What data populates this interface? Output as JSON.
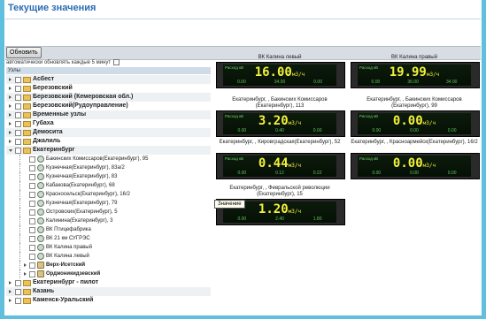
{
  "page": {
    "title": "Текущие значения"
  },
  "toolbar": {
    "refresh_label": "Обновить",
    "auto_refresh_label": "автоматически обновлять каждые 5 минут"
  },
  "tree": {
    "header": "Узлы",
    "nodes": [
      {
        "label": "Асбест",
        "kind": "top",
        "expanded": false
      },
      {
        "label": "Березовский",
        "kind": "top",
        "expanded": false
      },
      {
        "label": "Березовский (Кемеровская обл.)",
        "kind": "top",
        "expanded": false
      },
      {
        "label": "Березовский(Рудоуправление)",
        "kind": "top",
        "expanded": false
      },
      {
        "label": "Временные узлы",
        "kind": "top",
        "expanded": false
      },
      {
        "label": "Губаха",
        "kind": "top",
        "expanded": false
      },
      {
        "label": "Демосита",
        "kind": "top",
        "expanded": false
      },
      {
        "label": "Джалиль",
        "kind": "top",
        "expanded": false
      },
      {
        "label": "Екатеринбург",
        "kind": "top",
        "expanded": true
      },
      {
        "label": "Бакинских Комиссаров(Екатеринбург), 95",
        "kind": "child"
      },
      {
        "label": "Кузнечная(Екатеринбург), 83а/2",
        "kind": "child"
      },
      {
        "label": "Кузнечная(Екатеринбург), 83",
        "kind": "child"
      },
      {
        "label": "Кабакова(Екатеринбург), 68",
        "kind": "child"
      },
      {
        "label": "Красносельск(Екатеринбург), 16/2",
        "kind": "child"
      },
      {
        "label": "Кузнечная(Екатеринбург), 79",
        "kind": "child"
      },
      {
        "label": "Островских(Екатеринбург), 5",
        "kind": "child"
      },
      {
        "label": "Калинина(Екатеринбург), 3",
        "kind": "child"
      },
      {
        "label": "ВК Птицефабрика",
        "kind": "child"
      },
      {
        "label": "ВК 21 км СУГРЭС",
        "kind": "child"
      },
      {
        "label": "ВК Калина правый",
        "kind": "child"
      },
      {
        "label": "ВК Калина левый",
        "kind": "child"
      },
      {
        "label": "Верх-Исетский",
        "kind": "subfolder"
      },
      {
        "label": "Орджоникидзевский",
        "kind": "subfolder"
      },
      {
        "label": "Екатеринбург - пилот",
        "kind": "top",
        "expanded": false
      },
      {
        "label": "Казань",
        "kind": "top",
        "expanded": false
      },
      {
        "label": "Каменск-Уральский",
        "kind": "top",
        "expanded": false
      }
    ]
  },
  "meters": [
    {
      "caption": "ВК Калина левый",
      "tag": "Расход кВ",
      "value": "16.00",
      "unit": "м3/ч",
      "sub": [
        "0.00",
        "34.00",
        "0.00"
      ]
    },
    {
      "caption": "ВК Калина правый",
      "tag": "Расход кВ",
      "value": "19.99",
      "unit": "м3/ч",
      "sub": [
        "0.00",
        "36.00",
        "34.00"
      ]
    },
    {
      "caption": "Екатеринбург, , Бакинских Комиссаров (Екатеринбург), 113",
      "tag": "Расход кВ",
      "value": "3.20",
      "unit": "м3/ч",
      "sub": [
        "0.00",
        "0.40",
        "0.00"
      ]
    },
    {
      "caption": "Екатеринбург, , Бакинских Комиссаров (Екатеринбург), 99",
      "tag": "Расход кВ",
      "value": "0.00",
      "unit": "м3/ч",
      "sub": [
        "0.00",
        "0.00",
        "0.00"
      ]
    },
    {
      "caption": "Екатеринбург, , Кировградская(Екатеринбург), 52",
      "tag": "Расход кВ",
      "value": "0.44",
      "unit": "м3/ч",
      "sub": [
        "0.00",
        "0.12",
        "0.22"
      ]
    },
    {
      "caption": "Екатеринбург, , Красноармейск(Екатеринбург), 16/2",
      "tag": "Расход кВ",
      "value": "0.00",
      "unit": "м3/ч",
      "sub": [
        "0.00",
        "0.00",
        "0.00"
      ]
    },
    {
      "caption": "Екатеринбург, , Февральской революции (Екатеринбург), 15",
      "tag": "Расход кВ",
      "value": "1.20",
      "unit": "м3/ч",
      "sub": [
        "0.00",
        "2.40",
        "1.80"
      ]
    }
  ],
  "tooltip": {
    "text": "Значение"
  },
  "colors": {
    "accent": "#2a6cb5",
    "strip": "#5fbfdc",
    "digits": "#f3f13a",
    "display": "#0b1b0b"
  }
}
